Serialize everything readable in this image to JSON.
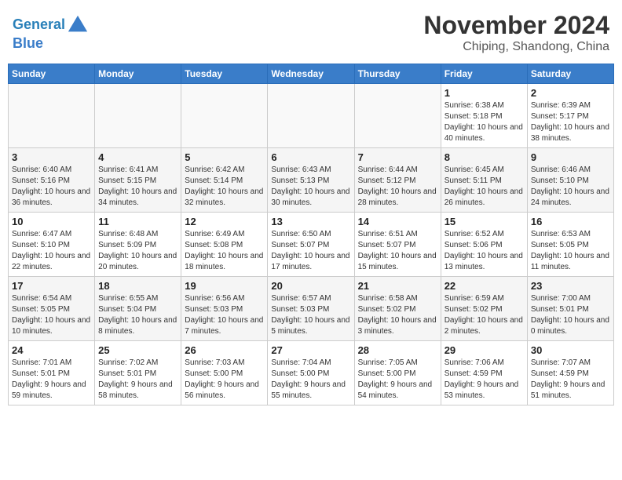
{
  "header": {
    "logo_line1": "General",
    "logo_line2": "Blue",
    "month_title": "November 2024",
    "location": "Chiping, Shandong, China"
  },
  "weekdays": [
    "Sunday",
    "Monday",
    "Tuesday",
    "Wednesday",
    "Thursday",
    "Friday",
    "Saturday"
  ],
  "weeks": [
    [
      {
        "day": "",
        "info": ""
      },
      {
        "day": "",
        "info": ""
      },
      {
        "day": "",
        "info": ""
      },
      {
        "day": "",
        "info": ""
      },
      {
        "day": "",
        "info": ""
      },
      {
        "day": "1",
        "info": "Sunrise: 6:38 AM\nSunset: 5:18 PM\nDaylight: 10 hours and 40 minutes."
      },
      {
        "day": "2",
        "info": "Sunrise: 6:39 AM\nSunset: 5:17 PM\nDaylight: 10 hours and 38 minutes."
      }
    ],
    [
      {
        "day": "3",
        "info": "Sunrise: 6:40 AM\nSunset: 5:16 PM\nDaylight: 10 hours and 36 minutes."
      },
      {
        "day": "4",
        "info": "Sunrise: 6:41 AM\nSunset: 5:15 PM\nDaylight: 10 hours and 34 minutes."
      },
      {
        "day": "5",
        "info": "Sunrise: 6:42 AM\nSunset: 5:14 PM\nDaylight: 10 hours and 32 minutes."
      },
      {
        "day": "6",
        "info": "Sunrise: 6:43 AM\nSunset: 5:13 PM\nDaylight: 10 hours and 30 minutes."
      },
      {
        "day": "7",
        "info": "Sunrise: 6:44 AM\nSunset: 5:12 PM\nDaylight: 10 hours and 28 minutes."
      },
      {
        "day": "8",
        "info": "Sunrise: 6:45 AM\nSunset: 5:11 PM\nDaylight: 10 hours and 26 minutes."
      },
      {
        "day": "9",
        "info": "Sunrise: 6:46 AM\nSunset: 5:10 PM\nDaylight: 10 hours and 24 minutes."
      }
    ],
    [
      {
        "day": "10",
        "info": "Sunrise: 6:47 AM\nSunset: 5:10 PM\nDaylight: 10 hours and 22 minutes."
      },
      {
        "day": "11",
        "info": "Sunrise: 6:48 AM\nSunset: 5:09 PM\nDaylight: 10 hours and 20 minutes."
      },
      {
        "day": "12",
        "info": "Sunrise: 6:49 AM\nSunset: 5:08 PM\nDaylight: 10 hours and 18 minutes."
      },
      {
        "day": "13",
        "info": "Sunrise: 6:50 AM\nSunset: 5:07 PM\nDaylight: 10 hours and 17 minutes."
      },
      {
        "day": "14",
        "info": "Sunrise: 6:51 AM\nSunset: 5:07 PM\nDaylight: 10 hours and 15 minutes."
      },
      {
        "day": "15",
        "info": "Sunrise: 6:52 AM\nSunset: 5:06 PM\nDaylight: 10 hours and 13 minutes."
      },
      {
        "day": "16",
        "info": "Sunrise: 6:53 AM\nSunset: 5:05 PM\nDaylight: 10 hours and 11 minutes."
      }
    ],
    [
      {
        "day": "17",
        "info": "Sunrise: 6:54 AM\nSunset: 5:05 PM\nDaylight: 10 hours and 10 minutes."
      },
      {
        "day": "18",
        "info": "Sunrise: 6:55 AM\nSunset: 5:04 PM\nDaylight: 10 hours and 8 minutes."
      },
      {
        "day": "19",
        "info": "Sunrise: 6:56 AM\nSunset: 5:03 PM\nDaylight: 10 hours and 7 minutes."
      },
      {
        "day": "20",
        "info": "Sunrise: 6:57 AM\nSunset: 5:03 PM\nDaylight: 10 hours and 5 minutes."
      },
      {
        "day": "21",
        "info": "Sunrise: 6:58 AM\nSunset: 5:02 PM\nDaylight: 10 hours and 3 minutes."
      },
      {
        "day": "22",
        "info": "Sunrise: 6:59 AM\nSunset: 5:02 PM\nDaylight: 10 hours and 2 minutes."
      },
      {
        "day": "23",
        "info": "Sunrise: 7:00 AM\nSunset: 5:01 PM\nDaylight: 10 hours and 0 minutes."
      }
    ],
    [
      {
        "day": "24",
        "info": "Sunrise: 7:01 AM\nSunset: 5:01 PM\nDaylight: 9 hours and 59 minutes."
      },
      {
        "day": "25",
        "info": "Sunrise: 7:02 AM\nSunset: 5:01 PM\nDaylight: 9 hours and 58 minutes."
      },
      {
        "day": "26",
        "info": "Sunrise: 7:03 AM\nSunset: 5:00 PM\nDaylight: 9 hours and 56 minutes."
      },
      {
        "day": "27",
        "info": "Sunrise: 7:04 AM\nSunset: 5:00 PM\nDaylight: 9 hours and 55 minutes."
      },
      {
        "day": "28",
        "info": "Sunrise: 7:05 AM\nSunset: 5:00 PM\nDaylight: 9 hours and 54 minutes."
      },
      {
        "day": "29",
        "info": "Sunrise: 7:06 AM\nSunset: 4:59 PM\nDaylight: 9 hours and 53 minutes."
      },
      {
        "day": "30",
        "info": "Sunrise: 7:07 AM\nSunset: 4:59 PM\nDaylight: 9 hours and 51 minutes."
      }
    ]
  ]
}
